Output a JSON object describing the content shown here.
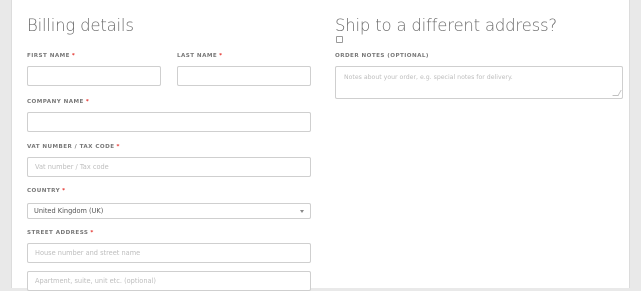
{
  "billing": {
    "title": "Billing details",
    "first_name": {
      "label": "FIRST NAME",
      "required": "*",
      "value": ""
    },
    "last_name": {
      "label": "LAST NAME",
      "required": "*",
      "value": ""
    },
    "company_name": {
      "label": "COMPANY NAME",
      "required": "*",
      "value": ""
    },
    "vat": {
      "label": "VAT NUMBER / TAX CODE",
      "required": "*",
      "placeholder": "Vat number / Tax code"
    },
    "country": {
      "label": "COUNTRY",
      "required": "*",
      "selected": "United Kingdom (UK)"
    },
    "street": {
      "label": "STREET ADDRESS",
      "required": "*",
      "placeholder_line1": "House number and street name",
      "placeholder_line2": "Apartment, suite, unit etc. (optional)"
    }
  },
  "shipping": {
    "title": "Ship to a different address?",
    "checked": false,
    "order_notes": {
      "label": "ORDER NOTES (OPTIONAL)",
      "placeholder": "Notes about your order, e.g. special notes for delivery."
    }
  },
  "colors": {
    "required": "#e4312b",
    "border": "#cfcfcf",
    "background": "#e9e9e9"
  }
}
